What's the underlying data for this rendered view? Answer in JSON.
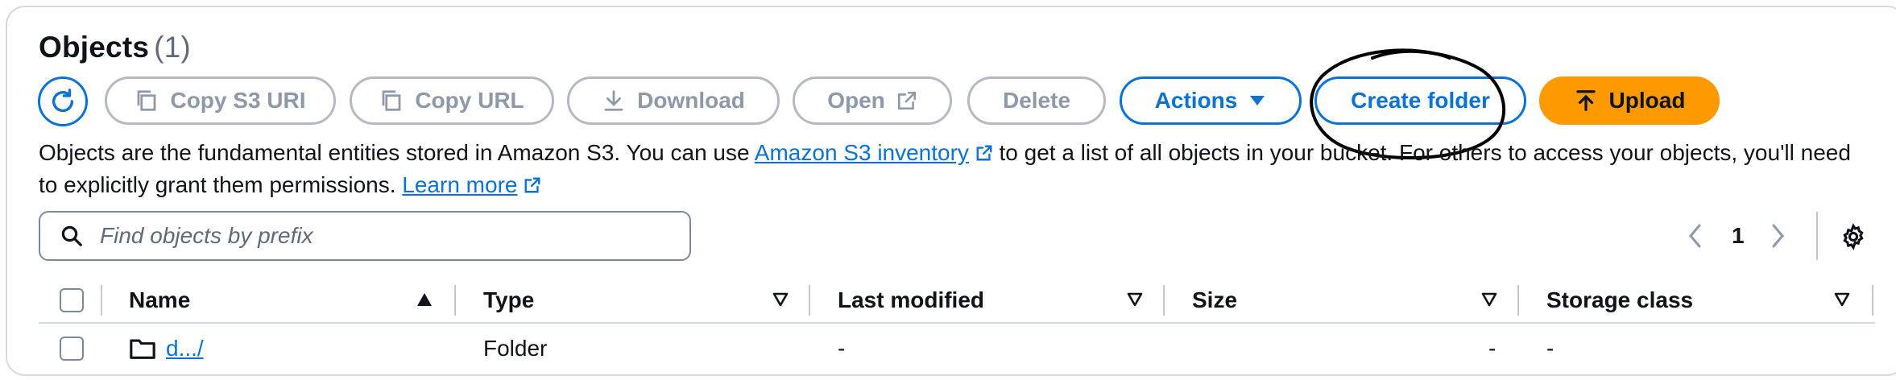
{
  "header": {
    "title": "Objects",
    "count": "(1)"
  },
  "toolbar": {
    "copy_s3_uri": "Copy S3 URI",
    "copy_url": "Copy URL",
    "download": "Download",
    "open": "Open",
    "delete": "Delete",
    "actions": "Actions",
    "create_folder": "Create folder",
    "upload": "Upload"
  },
  "description": {
    "part1": "Objects are the fundamental entities stored in Amazon S3. You can use ",
    "link1": "Amazon S3 inventory",
    "part2": " to get a list of all objects in your bucket. For others to access your objects, you'll need to explicitly grant them permissions. ",
    "link2": "Learn more"
  },
  "search": {
    "placeholder": "Find objects by prefix"
  },
  "pagination": {
    "current_page": "1"
  },
  "table": {
    "columns": [
      "Name",
      "Type",
      "Last modified",
      "Size",
      "Storage class"
    ],
    "rows": [
      {
        "name": "d.../",
        "type": "Folder",
        "last_modified": "-",
        "size": "-",
        "storage_class": "-"
      }
    ]
  },
  "colors": {
    "accent": "#0972d3",
    "primary": "#ff9900",
    "disabled": "#8d99a8",
    "border": "#d5d9e0"
  }
}
